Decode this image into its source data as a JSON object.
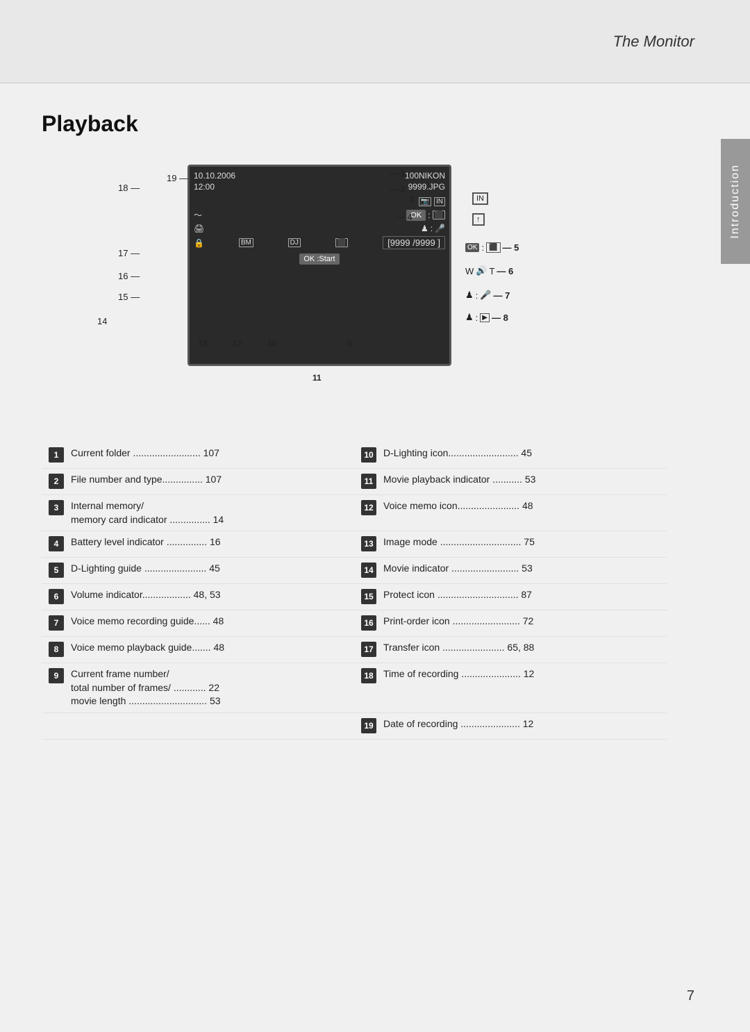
{
  "header": {
    "title": "The Monitor"
  },
  "sidebar": {
    "label": "Introduction"
  },
  "page_number": "7",
  "section": {
    "title": "Playback"
  },
  "screen": {
    "date": "10.10.2006",
    "time": "12:00",
    "folder": "100NIKON",
    "filename": "9999.JPG",
    "counter": "[9999 /9999 ]",
    "ok_start": "OK :Start"
  },
  "items": [
    {
      "num": "1",
      "text": "Current folder ......................... 107"
    },
    {
      "num": "2",
      "text": "File number and type............... 107"
    },
    {
      "num": "3",
      "text": "Internal memory/\nmemory card indicator ............... 14"
    },
    {
      "num": "4",
      "text": "Battery level indicator ............... 16"
    },
    {
      "num": "5",
      "text": "D-Lighting guide ....................... 45"
    },
    {
      "num": "6",
      "text": "Volume indicator.................. 48, 53"
    },
    {
      "num": "7",
      "text": "Voice memo recording guide...... 48"
    },
    {
      "num": "8",
      "text": "Voice memo playback guide....... 48"
    },
    {
      "num": "9",
      "text": "Current frame number/\ntotal number of frames/ ............ 22\nmovie length ............................. 53"
    },
    {
      "num": "10",
      "text": "D-Lighting icon.......................... 45"
    },
    {
      "num": "11",
      "text": "Movie playback indicator ........... 53"
    },
    {
      "num": "12",
      "text": "Voice memo icon....................... 48"
    },
    {
      "num": "13",
      "text": "Image mode .............................. 75"
    },
    {
      "num": "14",
      "text": "Movie indicator ......................... 53"
    },
    {
      "num": "15",
      "text": "Protect icon .............................. 87"
    },
    {
      "num": "16",
      "text": "Print-order icon ......................... 72"
    },
    {
      "num": "17",
      "text": "Transfer icon ....................... 65, 88"
    },
    {
      "num": "18",
      "text": "Time of recording ...................... 12"
    },
    {
      "num": "19",
      "text": "Date of recording ...................... 12"
    }
  ]
}
